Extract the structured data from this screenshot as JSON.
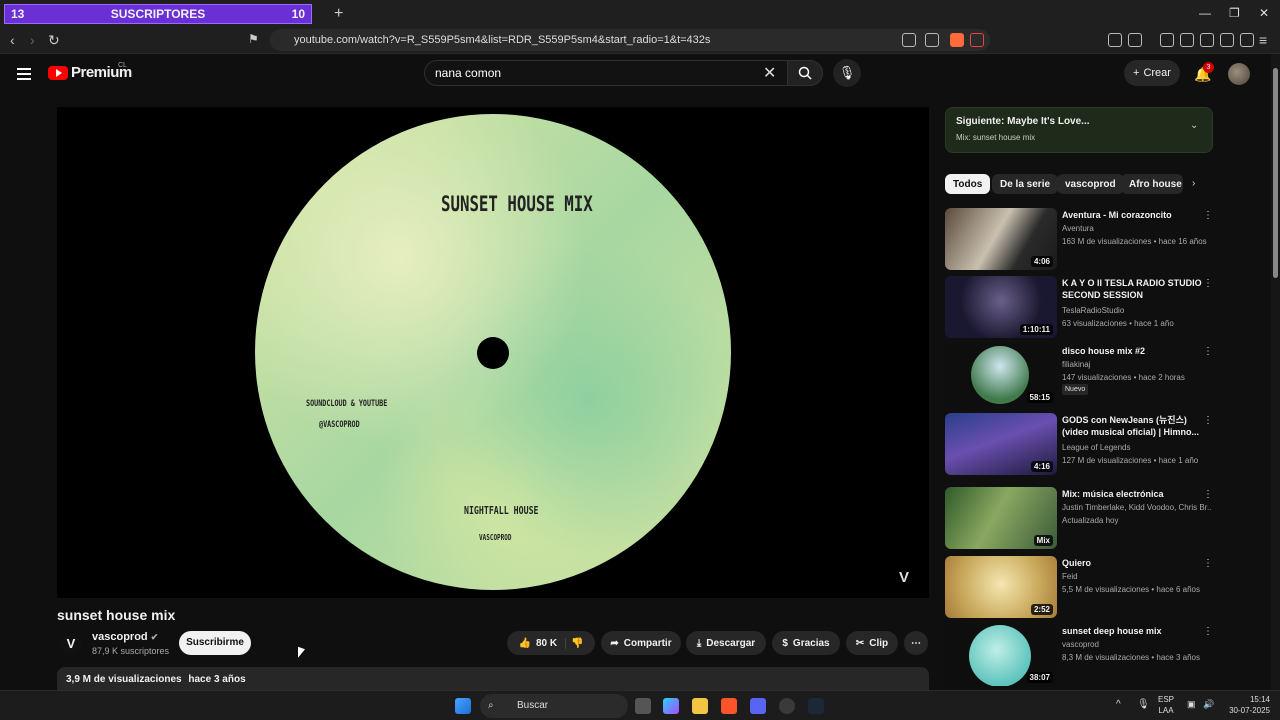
{
  "browser": {
    "tab": {
      "left_num": "13",
      "label": "SUSCRIPTORES",
      "right_num": "10"
    },
    "url": "youtube.com/watch?v=R_S559P5sm4&list=RDR_S559P5sm4&start_radio=1&t=432s"
  },
  "yt": {
    "logo_text": "Premium",
    "region": "CL",
    "search_value": "nana comon",
    "create_label": "Crear",
    "notif_count": "3"
  },
  "video": {
    "disc_title": "SUNSET HOUSE MIX",
    "disc_line1": "SOUNDCLOUD & YOUTUBE",
    "disc_line2": "@VASCOPROD",
    "disc_line3": "NIGHTFALL HOUSE",
    "disc_line4": "VASCOPROD",
    "watermark": "V",
    "title": "sunset house mix",
    "channel_initial": "V",
    "channel": "vascoprod",
    "subs": "87,9 K suscriptores",
    "subscribe": "Suscribirme",
    "likes": "80 K",
    "share": "Compartir",
    "download": "Descargar",
    "thanks": "Gracias",
    "clip": "Clip",
    "desc_views": "3,9 M de visualizaciones",
    "desc_age": "hace 3 años"
  },
  "sidebar": {
    "next_title": "Siguiente: Maybe It's Love...",
    "next_sub": "Mix: sunset house mix",
    "chips": [
      "Todos",
      "De la serie",
      "vascoprod",
      "Afro house"
    ],
    "recs": [
      {
        "title": "Aventura - Mi corazoncito",
        "channel": "Aventura",
        "meta": "163 M de visualizaciones • hace 16 años",
        "dur": "4:06"
      },
      {
        "title": "K A Y O  II TESLA RADIO STUDIO SECOND SESSION",
        "channel": "TeslaRadioStudio",
        "meta": "63 visualizaciones • hace 1 año",
        "dur": "1:10:11"
      },
      {
        "title": "disco house mix #2",
        "channel": "filiakinaj",
        "meta": "147 visualizaciones • hace 2 horas",
        "dur": "58:15",
        "badge": "Nuevo"
      },
      {
        "title": "GODS con NewJeans (뉴진스) (video musical oficial) | Himno...",
        "channel": "League of Legends",
        "meta": "127 M de visualizaciones • hace 1 año",
        "dur": "4:16"
      },
      {
        "title": "Mix: música electrónica",
        "channel": "Justin Timberlake, Kidd Voodoo, Chris Br...",
        "meta": "Actualizada hoy",
        "dur": "Mix"
      },
      {
        "title": "Quiero",
        "channel": "Feid",
        "meta": "5,5 M de visualizaciones • hace 6 años",
        "dur": "2:52"
      },
      {
        "title": "sunset deep house mix",
        "channel": "vascoprod",
        "meta": "8,3 M de visualizaciones • hace 3 años",
        "dur": "38:07"
      }
    ]
  },
  "taskbar": {
    "search": "Buscar",
    "lang1": "ESP",
    "lang2": "LAA",
    "time": "15:14",
    "date": "30-07-2025"
  }
}
